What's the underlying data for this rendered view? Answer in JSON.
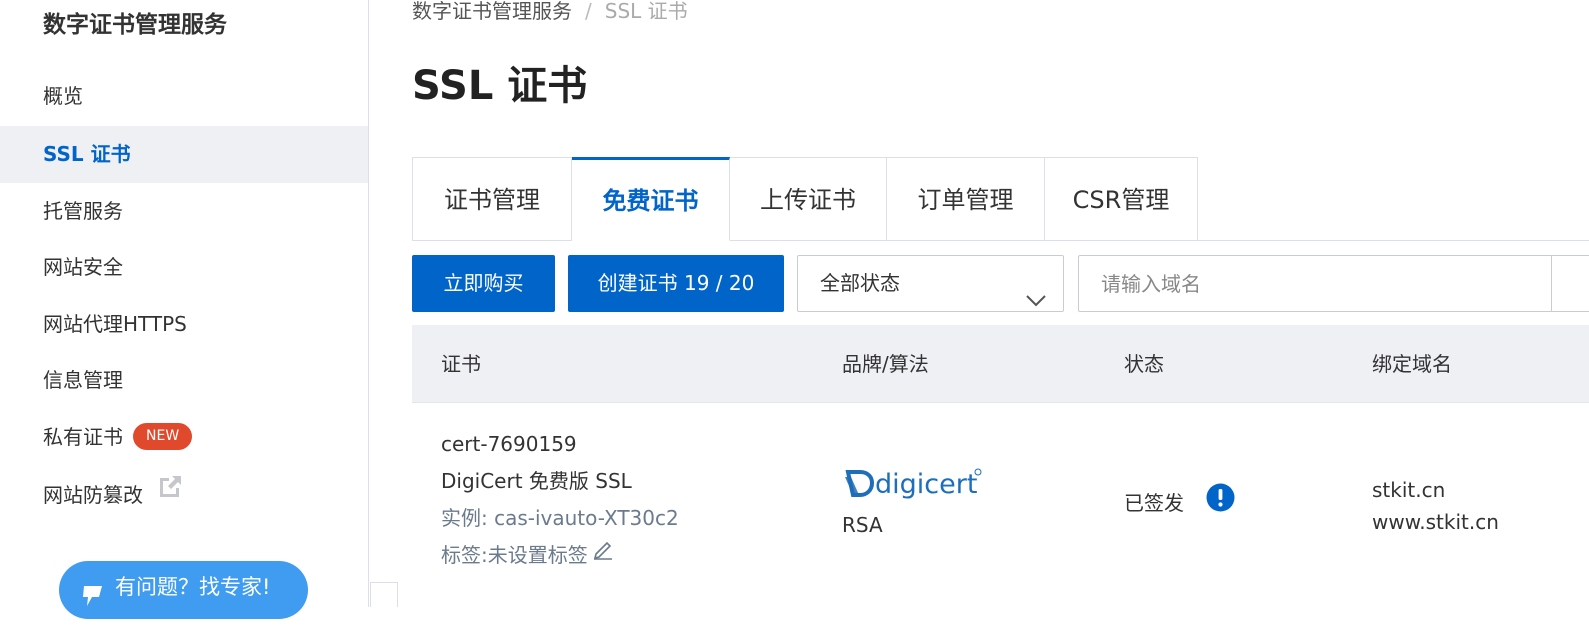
{
  "sidebar": {
    "title": "数字证书管理服务",
    "items": [
      {
        "label": "概览"
      },
      {
        "label": "SSL 证书"
      },
      {
        "label": "托管服务"
      },
      {
        "label": "网站安全"
      },
      {
        "label": "网站代理HTTPS"
      },
      {
        "label": "信息管理"
      },
      {
        "label": "私有证书",
        "badge": "NEW"
      },
      {
        "label": "网站防篡改"
      }
    ],
    "help_button": "有问题？找专家!"
  },
  "breadcrumb": {
    "root": "数字证书管理服务",
    "separator": "/",
    "current": "SSL 证书"
  },
  "page_title": "SSL 证书",
  "tabs": [
    {
      "label": "证书管理"
    },
    {
      "label": "免费证书"
    },
    {
      "label": "上传证书"
    },
    {
      "label": "订单管理"
    },
    {
      "label": "CSR管理"
    }
  ],
  "toolbar": {
    "buy_label": "立即购买",
    "create_label": "创建证书 19 / 20",
    "status_select": "全部状态",
    "domain_placeholder": "请输入域名"
  },
  "table": {
    "headers": [
      "证书",
      "品牌/算法",
      "状态",
      "绑定域名"
    ],
    "rows": [
      {
        "cert_id": "cert-7690159",
        "cert_name": "DigiCert 免费版 SSL",
        "instance": "实例: cas-ivauto-XT30c2",
        "tags": "标签:未设置标签",
        "brand": "digicert",
        "algorithm": "RSA",
        "status": "已签发",
        "domains": [
          "stkit.cn",
          "www.stkit.cn"
        ]
      }
    ]
  },
  "colors": {
    "primary": "#0064c8",
    "badge": "#e0492c",
    "help": "#3f9cf0",
    "status_icon": "#0064c8",
    "digicert": "#1c6fb8"
  }
}
